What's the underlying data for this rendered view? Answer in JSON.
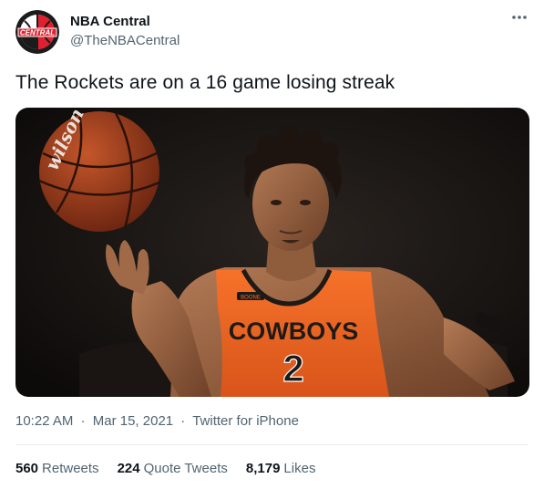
{
  "author": {
    "display_name": "NBA Central",
    "handle": "@TheNBACentral",
    "avatar_text": "CENTRAL"
  },
  "tweet": {
    "text": "The Rockets are on a 16 game losing streak"
  },
  "media": {
    "jersey_word": "COWBOYS",
    "jersey_number": "2",
    "jersey_patch": "BOONE",
    "ball_brand": "wilson"
  },
  "meta": {
    "time": "10:22 AM",
    "date": "Mar 15, 2021",
    "source": "Twitter for iPhone",
    "separator": "·"
  },
  "stats": {
    "retweets_count": "560",
    "retweets_label": "Retweets",
    "quotes_count": "224",
    "quotes_label": "Quote Tweets",
    "likes_count": "8,179",
    "likes_label": "Likes"
  },
  "colors": {
    "accent_text": "#536471",
    "jersey_orange": "#f0641c"
  }
}
